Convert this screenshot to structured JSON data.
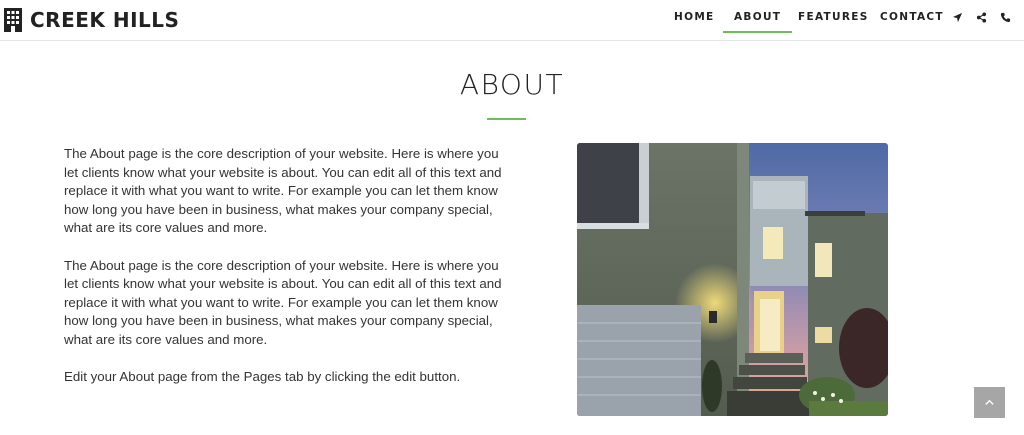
{
  "brand": {
    "name": "CREEK HILLS",
    "icon": "building-icon"
  },
  "nav": {
    "items": [
      {
        "label": "HOME"
      },
      {
        "label": "ABOUT",
        "active": true
      },
      {
        "label": "FEATURES"
      },
      {
        "label": "CONTACT"
      }
    ],
    "icons": [
      "location-arrow-icon",
      "share-icon",
      "phone-icon"
    ]
  },
  "page": {
    "title": "ABOUT"
  },
  "content": {
    "paragraphs": [
      "The About page is the core description of your website. Here is where you let clients know what your website is about. You can edit all of this text and replace it with what you want to write. For example you can let them know how long you have been in business, what makes your company special, what are its core values and more.",
      "The About page is the core description of your website. Here is where you let clients know what your website is about. You can edit all of this text and replace it with what you want to write. For example you can let them know how long you have been in business, what makes your company special, what are its core values and more.",
      "Edit your About page from the Pages tab by clicking the edit button."
    ]
  },
  "image": {
    "subject": "modern-house-at-dusk"
  },
  "back_to_top": {
    "icon": "chevron-up-icon"
  },
  "colors": {
    "accent": "#6bbf59",
    "text": "#333333",
    "heading": "#222222",
    "back_to_top_bg": "#a6a6a6"
  }
}
